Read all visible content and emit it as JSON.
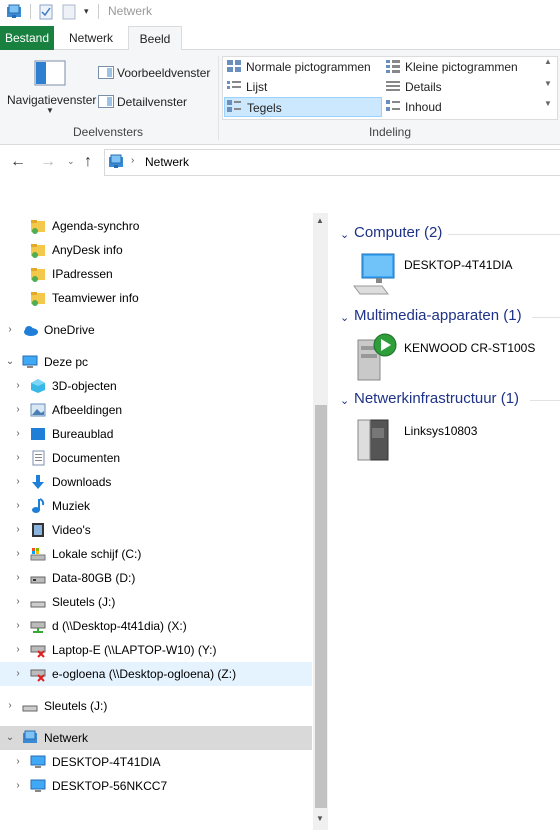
{
  "window": {
    "title": "Netwerk"
  },
  "ribbon": {
    "tabs": [
      "Bestand",
      "Netwerk",
      "Beeld"
    ],
    "panes_group": {
      "navigation_pane": "Navigatievenster",
      "preview_pane": "Voorbeeldvenster",
      "details_pane": "Detailvenster",
      "label": "Deelvensters"
    },
    "layout_group": {
      "options": [
        "Normale pictogrammen",
        "Kleine pictogrammen",
        "Lijst",
        "Details",
        "Tegels",
        "Inhoud"
      ],
      "selected": "Tegels",
      "label": "Indeling"
    }
  },
  "address": {
    "path": "Netwerk"
  },
  "nav_tree": {
    "quick_access": [
      "Agenda-synchro",
      "AnyDesk info",
      "IPadressen",
      "Teamviewer info"
    ],
    "onedrive": "OneDrive",
    "this_pc": "Deze pc",
    "this_pc_items": [
      "3D-objecten",
      "Afbeeldingen",
      "Bureaublad",
      "Documenten",
      "Downloads",
      "Muziek",
      "Video's",
      "Lokale schijf (C:)",
      "Data-80GB (D:)",
      "Sleutels (J:)",
      "d (\\\\Desktop-4t41dia) (X:)",
      "Laptop-E (\\\\LAPTOP-W10) (Y:)",
      "e-ogloena (\\\\Desktop-ogloena) (Z:)"
    ],
    "sleutels_root": "Sleutels (J:)",
    "network": "Netwerk",
    "network_items": [
      "DESKTOP-4T41DIA",
      "DESKTOP-56NKCC7"
    ]
  },
  "content": {
    "groups": [
      {
        "title": "Computer (2)",
        "items": [
          "DESKTOP-4T41DIA"
        ]
      },
      {
        "title": "Multimedia-apparaten (1)",
        "items": [
          "KENWOOD CR-ST100S"
        ]
      },
      {
        "title": "Netwerkinfrastructuur (1)",
        "items": [
          "Linksys10803"
        ]
      }
    ]
  },
  "colors": {
    "file_tab": "#19813f",
    "group_heading": "#1e3287",
    "selection": "#cce8ff",
    "nav_selected": "#d9d9d9"
  }
}
